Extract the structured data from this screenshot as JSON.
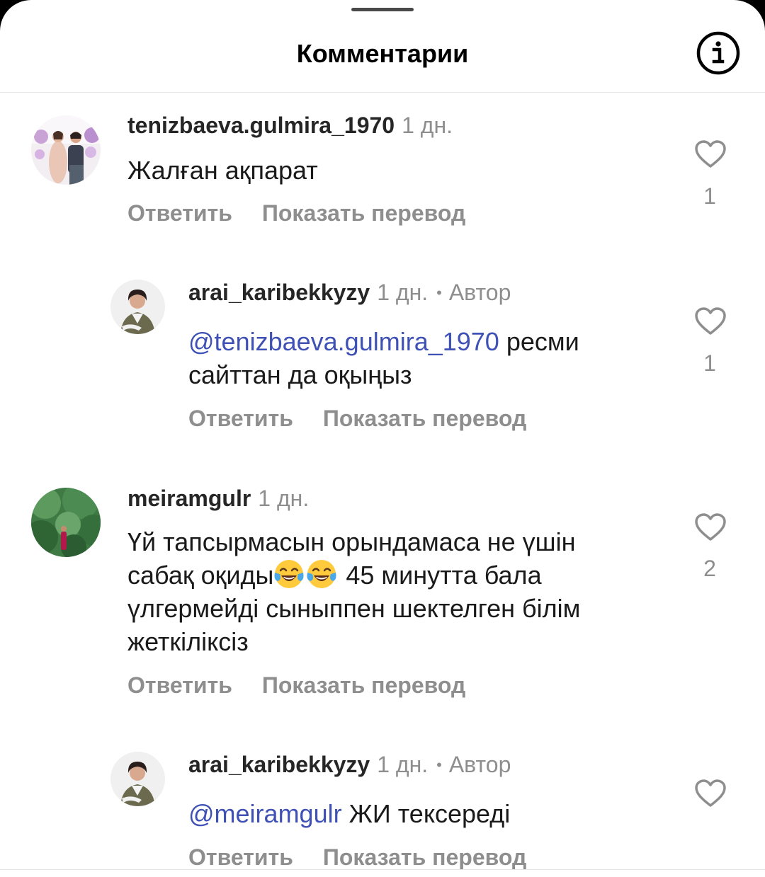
{
  "header": {
    "title": "Комментарии"
  },
  "comments": [
    {
      "username": "tenizbaeva.gulmira_1970",
      "time": "1 дн.",
      "text": "Жалған ақпарат",
      "reply": "Ответить",
      "translate": "Показать перевод",
      "likes": "1"
    },
    {
      "username": "arai_karibekkyzy",
      "time": "1 дн.",
      "separator": "•",
      "badge": "Автор",
      "mention": "@tenizbaeva.gulmira_1970",
      "text_line1": " ресми",
      "text_line2": "сайттан да оқыңыз",
      "reply": "Ответить",
      "translate": "Показать перевод",
      "likes": "1"
    },
    {
      "username": "meiramgulr",
      "time": "1 дн.",
      "text_line1": "Үй тапсырмасын орындамаса не үшін",
      "text_line2a": "сабақ оқиды",
      "text_line2b": " 45 минутта бала",
      "text_line3": "үлгермейді сыныппен шектелген білім",
      "text_line4": "жеткіліксіз",
      "reply": "Ответить",
      "translate": "Показать перевод",
      "likes": "2"
    },
    {
      "username": "arai_karibekkyzy",
      "time": "1 дн.",
      "separator": "•",
      "badge": "Автор",
      "mention": "@meiramgulr",
      "text": " ЖИ тексереді",
      "reply": "Ответить",
      "translate": "Показать перевод"
    }
  ],
  "icons": {
    "info": "info-icon",
    "heart": "heart-outline-icon",
    "emoji": "face-with-tears-of-joy"
  },
  "colors": {
    "mention": "#3f51b5",
    "secondary_text": "#8e8e8e",
    "username": "#262626"
  }
}
